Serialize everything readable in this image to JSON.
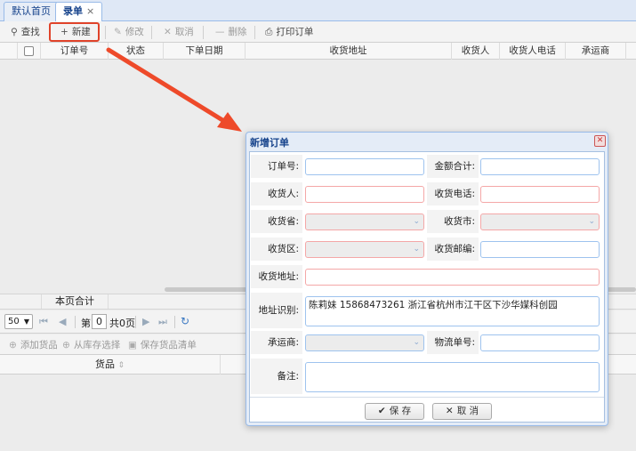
{
  "tabs": [
    {
      "label": "默认首页"
    },
    {
      "label": "录单",
      "close": "×"
    }
  ],
  "toolbar": {
    "search": "查找",
    "new": "新建",
    "edit": "修改",
    "cancel": "取消",
    "delete": "删除",
    "print": "打印订单"
  },
  "grid": {
    "columns": [
      "订单号",
      "状态",
      "下单日期",
      "收货地址",
      "收货人",
      "收货人电话",
      "承运商"
    ]
  },
  "summary": {
    "label": "本页合计"
  },
  "pager": {
    "page_size": "50",
    "page_prefix": "第",
    "page_value": "0",
    "page_suffix": "共0页"
  },
  "goods_toolbar": {
    "add": "添加货品",
    "from_stock": "从库存选择",
    "save_list": "保存货品清单"
  },
  "goods_grid": {
    "column": "货品"
  },
  "dialog": {
    "title": "新增订单",
    "labels": {
      "order_no": "订单号:",
      "total": "金额合计:",
      "receiver": "收货人:",
      "phone": "收货电话:",
      "province": "收货省:",
      "city": "收货市:",
      "district": "收货区:",
      "zip": "收货邮编:",
      "address": "收货地址:",
      "addr_recog": "地址识别:",
      "carrier": "承运商:",
      "tracking": "物流单号:",
      "remark": "备注:"
    },
    "addr_recog_value": "陈莉妹 15868473261 浙江省杭州市江干区下沙华媒科创园",
    "save": "保 存",
    "cancel": "取 消"
  },
  "colors": {
    "accent": "#15428b",
    "highlight": "#e0432a"
  }
}
